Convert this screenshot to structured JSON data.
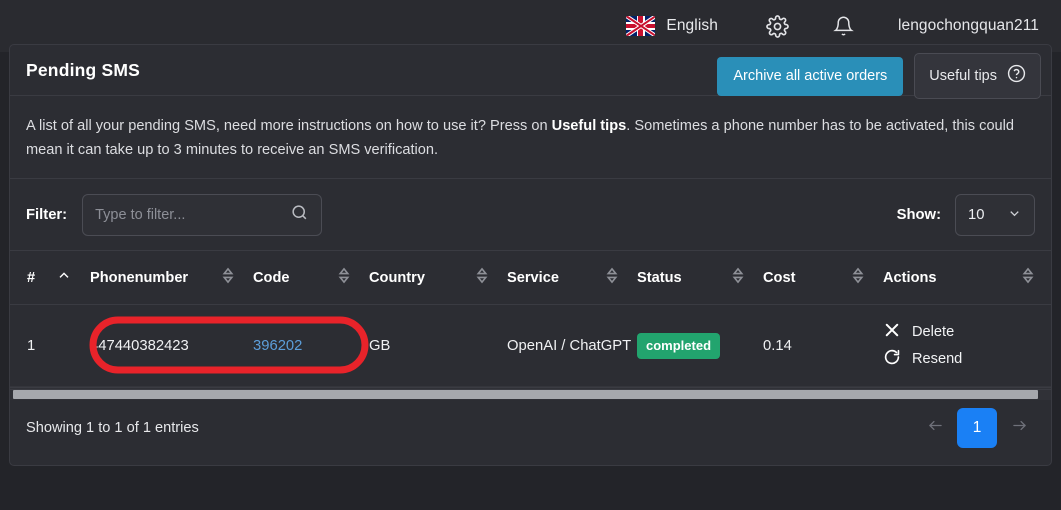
{
  "topbar": {
    "flag_icon": "uk-flag-icon",
    "language": "English",
    "settings_icon": "gear-icon",
    "notifications_icon": "bell-icon",
    "username": "lengochongquan211"
  },
  "card": {
    "title": "Pending SMS",
    "archive_button": "Archive all active orders",
    "tips_button": "Useful tips",
    "tips_icon": "question-circle-icon",
    "description_part1": "A list of all your pending SMS, need more instructions on how to use it? Press on ",
    "description_bold": "Useful tips",
    "description_part2": ". Sometimes a phone number has to be activated, this could mean it can take up to 3 minutes to receive an SMS verification."
  },
  "filter": {
    "label": "Filter:",
    "placeholder": "Type to filter...",
    "value": "",
    "search_icon": "search-icon",
    "show_label": "Show:",
    "show_value": "10",
    "show_chevron_icon": "chevron-down-icon"
  },
  "table": {
    "columns": [
      {
        "label": "#",
        "sort_icon": "chevron-up-icon"
      },
      {
        "label": "Phonenumber",
        "sort_icon": "sort-updown-icon"
      },
      {
        "label": "Code",
        "sort_icon": "sort-updown-icon"
      },
      {
        "label": "Country",
        "sort_icon": "sort-updown-icon"
      },
      {
        "label": "Service",
        "sort_icon": "sort-updown-icon"
      },
      {
        "label": "Status",
        "sort_icon": "sort-updown-icon"
      },
      {
        "label": "Cost",
        "sort_icon": "sort-updown-icon"
      },
      {
        "label": "Actions",
        "sort_icon": "sort-updown-icon"
      }
    ],
    "rows": [
      {
        "num": "1",
        "phonenumber": "447440382423",
        "code": "396202",
        "country": "GB",
        "service": "OpenAI / ChatGPT",
        "status": "completed",
        "cost": "0.14",
        "action_delete": "Delete",
        "action_delete_icon": "close-x-icon",
        "action_resend": "Resend",
        "action_resend_icon": "refresh-icon"
      }
    ]
  },
  "footer": {
    "showing": "Showing 1 to 1 of 1 entries",
    "prev_icon": "arrow-left-icon",
    "page": "1",
    "next_icon": "arrow-right-icon"
  },
  "annotation": {
    "shape": "red-rounded-rectangle-highlight",
    "color": "#e8232a"
  },
  "colors": {
    "accent_blue": "#2a8fb8",
    "pager_blue": "#1a80f5",
    "status_green": "#22a46e",
    "code_link": "#5c9eda",
    "annotation_red": "#e8232a"
  }
}
